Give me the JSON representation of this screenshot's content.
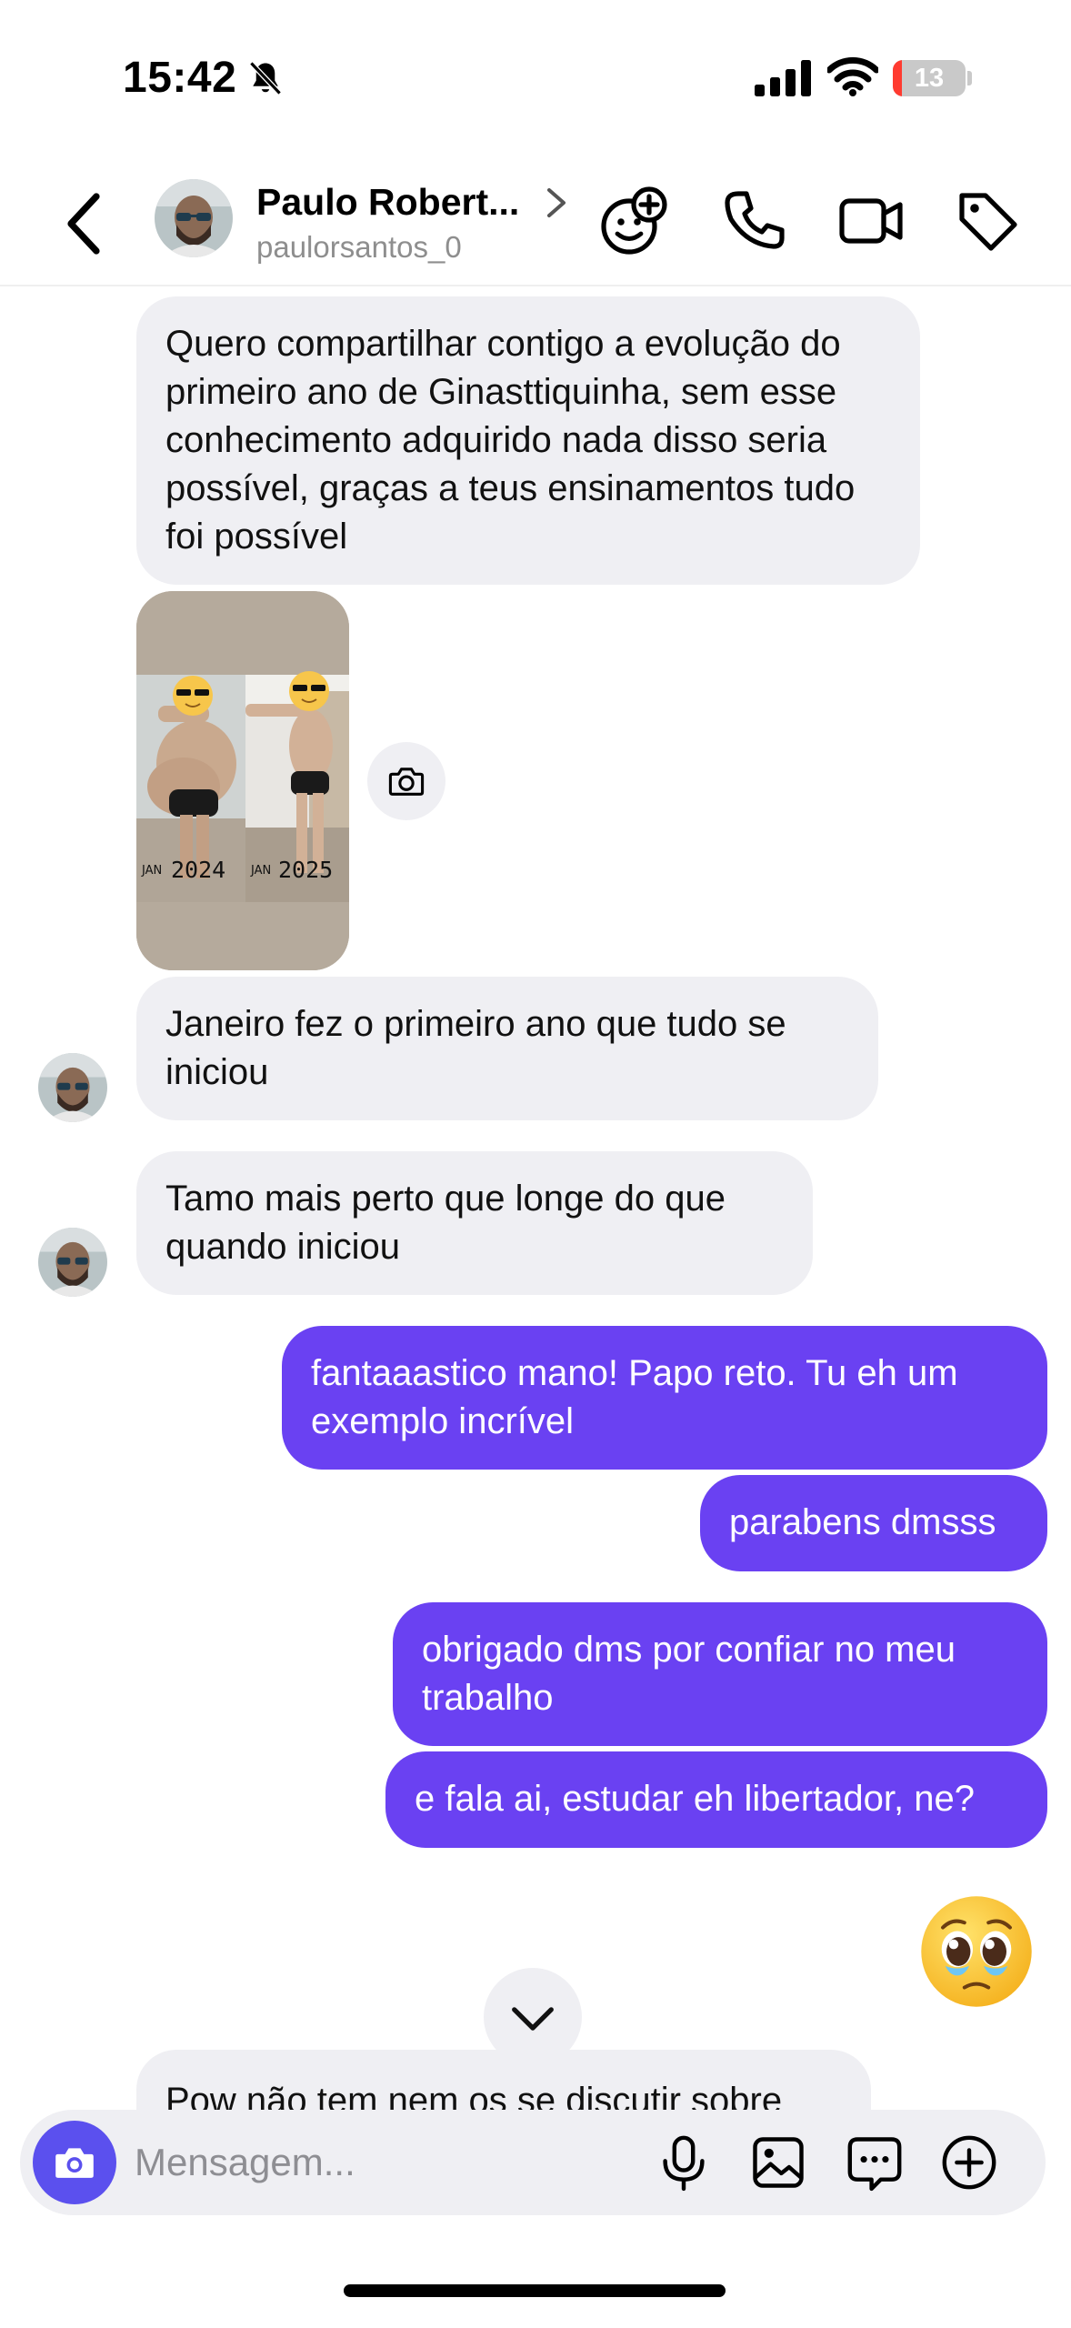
{
  "status": {
    "time": "15:42",
    "battery": "13",
    "battery_level_percent": 13,
    "icons": [
      "bell-slash-icon",
      "cellular-signal-icon",
      "wifi-icon",
      "battery-icon"
    ]
  },
  "header": {
    "name": "Paulo Robert...",
    "username": "paulorsantos_0",
    "icons": [
      "back-icon",
      "chevron-right-icon",
      "sticker-add-icon",
      "phone-icon",
      "video-icon",
      "tag-icon"
    ]
  },
  "messages": [
    {
      "from": "them",
      "text": "Quero compartilhar contigo a evolução do primeiro ano de Ginasttiquinha, sem esse conhecimento adquirido nada disso seria possível, graças a teus ensinamentos tudo foi possível"
    },
    {
      "from": "them",
      "type": "photo",
      "captions": [
        "JAN",
        "2024",
        "JAN",
        "2025"
      ]
    },
    {
      "from": "them",
      "text": "Janeiro fez o primeiro ano que tudo se iniciou"
    },
    {
      "from": "them",
      "text": "Tamo mais perto que longe do que quando iniciou"
    },
    {
      "from": "me",
      "text": "fantaaastico mano! Papo reto. Tu eh um exemplo incrível"
    },
    {
      "from": "me",
      "text": "parabens dmsss"
    },
    {
      "from": "me",
      "text": "obrigado dms por confiar no meu trabalho"
    },
    {
      "from": "me",
      "text": "e fala ai, estudar eh libertador, ne?"
    },
    {
      "from": "me",
      "type": "emoji",
      "emoji": "pleading-face"
    },
    {
      "from": "them",
      "text": "Pow não tem nem os se discutir sobre"
    }
  ],
  "composer": {
    "placeholder": "Mensagem...",
    "icons": [
      "camera-icon",
      "microphone-icon",
      "gallery-icon",
      "sticker-chat-icon",
      "plus-circle-icon"
    ]
  },
  "colors": {
    "accent_outgoing": "#6a41f2",
    "incoming_bubble": "#efeff3",
    "camera_button": "#5b50ee",
    "battery_low": "#ff3b30"
  }
}
